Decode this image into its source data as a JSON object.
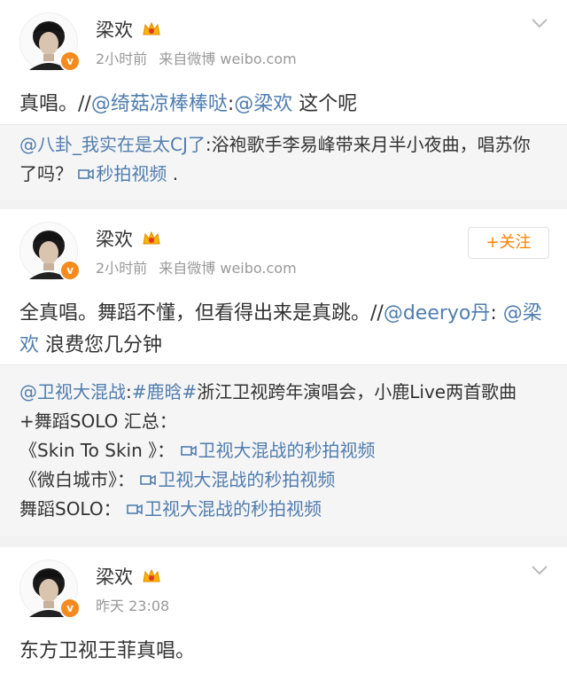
{
  "posts": [
    {
      "username": "梁欢",
      "time": "2小时前",
      "source": "来自微博 weibo.com",
      "text_plain": "真唱。//",
      "mention1": "@绮菇凉棒棒哒",
      "text_mid": ":",
      "mention2": "@梁欢",
      "text_end": " 这个呢",
      "repost": {
        "mention": "@八卦_我实在是太CJ了",
        "text": ":浴袍歌手李易峰带来月半小夜曲，唱苏你了吗？",
        "video_label": "秒拍视频",
        "tail": " ."
      }
    },
    {
      "username": "梁欢",
      "time": "2小时前",
      "source": "来自微博 weibo.com",
      "follow_label": "+关注",
      "text_plain": "全真唱。舞蹈不懂，但看得出来是真跳。//",
      "mention1": "@deeryo丹",
      "text_mid": ": ",
      "mention2": "@梁欢",
      "text_end": " 浪费您几分钟",
      "repost": {
        "mention": "@卫视大混战",
        "colon": ":",
        "hashtag": "#鹿晗#",
        "text": "浙江卫视跨年演唱会，小鹿Live两首歌曲+舞蹈SOLO 汇总：",
        "lines": [
          {
            "prefix": "《Skin To Skin 》：",
            "video_label": "卫视大混战的秒拍视频"
          },
          {
            "prefix": "《微白城市》：",
            "video_label": "卫视大混战的秒拍视频"
          },
          {
            "prefix": "舞蹈SOLO：",
            "video_label": "卫视大混战的秒拍视频"
          }
        ]
      }
    },
    {
      "username": "梁欢",
      "time": "昨天 23:08",
      "text": "东方卫视王菲真唱。"
    }
  ],
  "verified_badge": "v",
  "colors": {
    "link": "#507daf",
    "follow": "#ff8200",
    "badge": "#f58a1e"
  }
}
